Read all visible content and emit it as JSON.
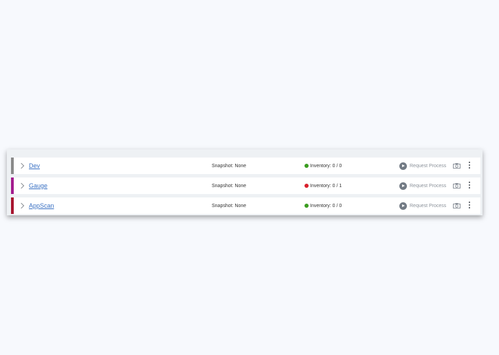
{
  "environments": [
    {
      "name": "Dev",
      "color": "#8a8a8a",
      "snapshot": "Snapshot: None",
      "inventory": "Inventory: 0 / 0",
      "status_color": "#3a9c1f",
      "action_label": "Request Process"
    },
    {
      "name": "Gauge",
      "color": "#a31c8e",
      "snapshot": "Snapshot: None",
      "inventory": "Inventory: 0 / 1",
      "status_color": "#d8202c",
      "action_label": "Request Process"
    },
    {
      "name": "AppScan",
      "color": "#a8152f",
      "snapshot": "Snapshot: None",
      "inventory": "Inventory: 0 / 0",
      "status_color": "#3a9c1f",
      "action_label": "Request Process"
    }
  ],
  "icons": {
    "expand": "chevron-right-icon",
    "status": "status-dot-icon",
    "action": "play-circle-icon",
    "snapshot": "camera-icon",
    "menu": "more-vertical-icon"
  }
}
